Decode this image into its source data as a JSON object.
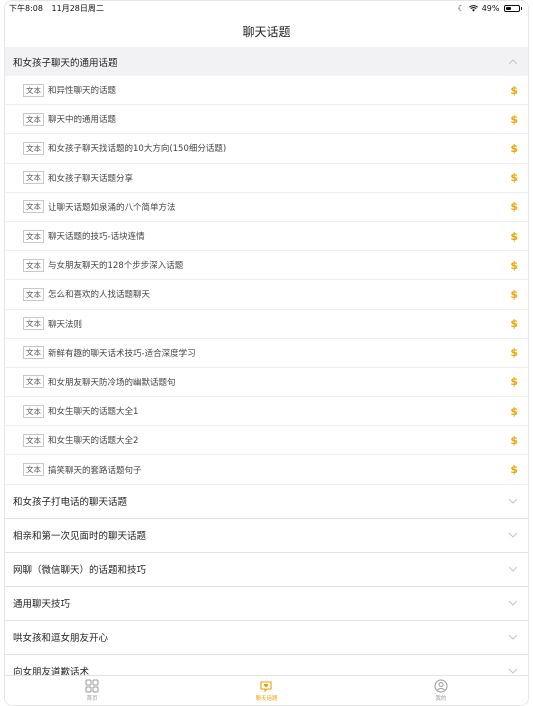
{
  "status_bar": {
    "time": "下午8:08",
    "date": "11月28日周二",
    "battery": "49%",
    "battery_level": 0.49
  },
  "nav": {
    "title": "聊天话题"
  },
  "expanded_section": {
    "title": "和女孩子聊天的通用话题",
    "tag_label": "文本",
    "items": [
      "和异性聊天的话题",
      "聊天中的通用话题",
      "和女孩子聊天找话题的10大方向(150细分话题)",
      "和女孩子聊天话题分享",
      "让聊天话题如泉涌的八个简单方法",
      "聊天话题的技巧-话块连情",
      "与女朋友聊天的128个步步深入话题",
      "怎么和喜欢的人找话题聊天",
      "聊天法则",
      "新鲜有趣的聊天话术技巧-适合深度学习",
      "和女朋友聊天防冷场的幽默话题句",
      "和女生聊天的话题大全1",
      "和女生聊天的话题大全2",
      "搞笑聊天的套路话题句子"
    ],
    "price_symbol": "$"
  },
  "collapsed_sections": [
    "和女孩子打电话的聊天话题",
    "相亲和第一次见面时的聊天话题",
    "网聊（微信聊天）的话题和技巧",
    "通用聊天技巧",
    "哄女孩和逗女朋友开心",
    "向女朋友道歉话术"
  ],
  "tab_bar": {
    "tabs": [
      {
        "label": "首页",
        "icon": "grid-icon",
        "active": false
      },
      {
        "label": "聊天话题",
        "icon": "chat-heart-icon",
        "active": true
      },
      {
        "label": "我的",
        "icon": "user-icon",
        "active": false
      }
    ],
    "accent_color": "#e8a000"
  }
}
